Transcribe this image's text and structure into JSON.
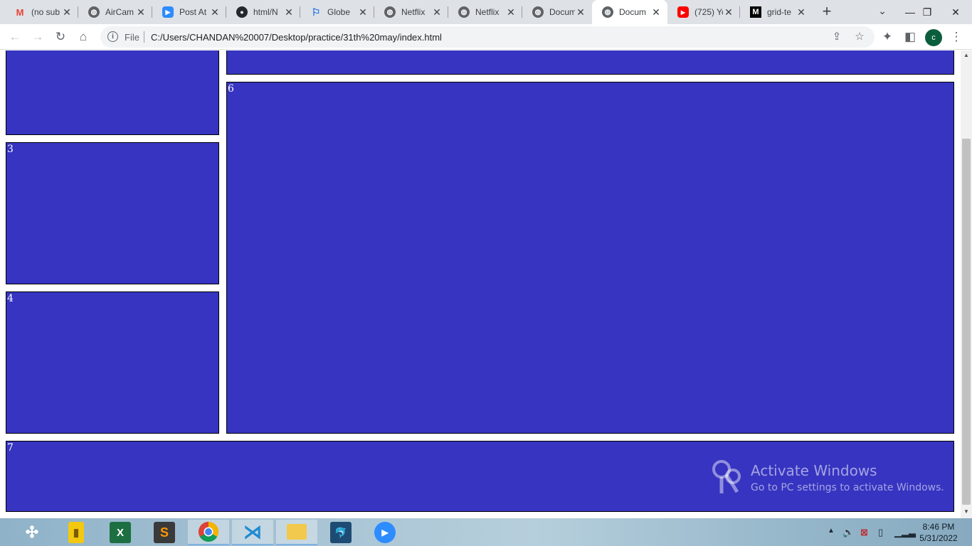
{
  "window": {
    "tabs": [
      {
        "title": "(no sub",
        "icon": "gmail-icon"
      },
      {
        "title": "AirCam",
        "icon": "globe-icon"
      },
      {
        "title": "Post At",
        "icon": "zoom-icon"
      },
      {
        "title": "html/N",
        "icon": "github-icon"
      },
      {
        "title": "Globe",
        "icon": "flag-icon"
      },
      {
        "title": "Netflix",
        "icon": "globe-icon"
      },
      {
        "title": "Netflix",
        "icon": "globe-icon"
      },
      {
        "title": "Docum",
        "icon": "globe-icon"
      },
      {
        "title": "Docum",
        "icon": "globe-icon",
        "active": true
      },
      {
        "title": "(725) Yo",
        "icon": "youtube-icon"
      },
      {
        "title": "grid-te",
        "icon": "medium-icon"
      }
    ]
  },
  "toolbar": {
    "scheme_label": "File",
    "url": "C:/Users/CHANDAN%20007/Desktop/practice/31th%20may/index.html",
    "profile_initial": "c"
  },
  "page": {
    "box_color": "#3634c0",
    "boxes": [
      {
        "label": ""
      },
      {
        "label": ""
      },
      {
        "label": "3"
      },
      {
        "label": "4"
      },
      {
        "label": "6"
      },
      {
        "label": "7"
      }
    ]
  },
  "watermark": {
    "title": "Activate Windows",
    "subtitle": "Go to PC settings to activate Windows."
  },
  "taskbar": {
    "apps": [
      "tableau-icon",
      "powerbi-icon",
      "excel-icon",
      "sublime-icon",
      "chrome-icon",
      "vscode-icon",
      "file-explorer-icon",
      "mysql-workbench-icon",
      "zoom-icon"
    ],
    "time": "8:46 PM",
    "date": "5/31/2022"
  }
}
